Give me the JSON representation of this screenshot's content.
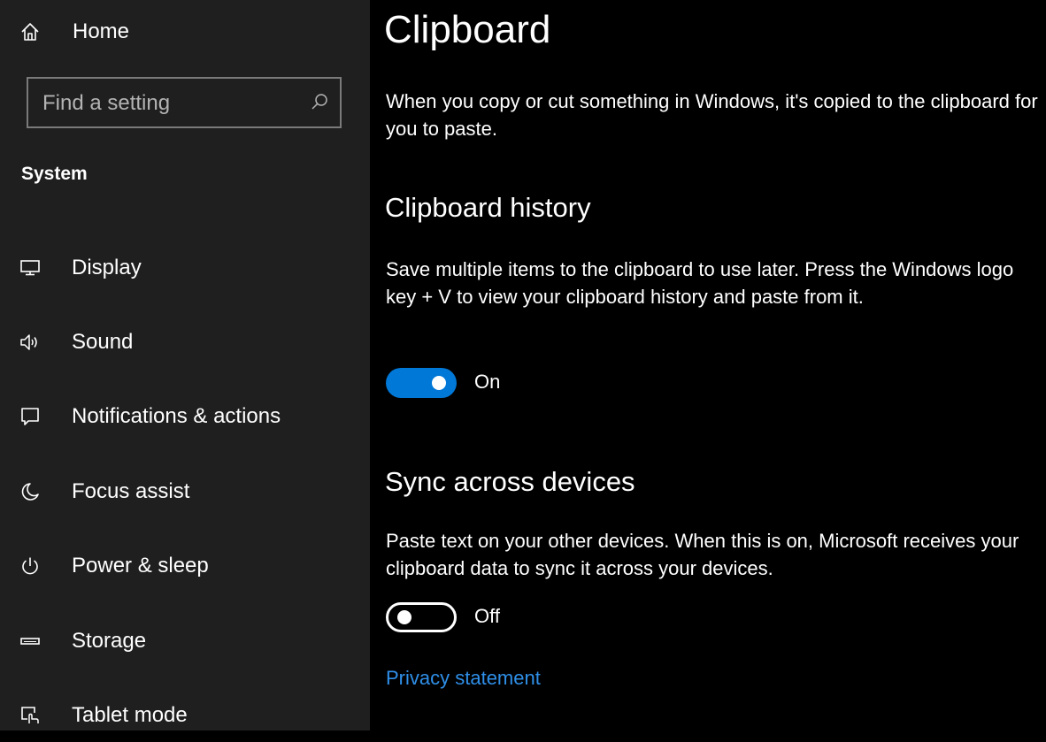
{
  "sidebar": {
    "home_label": "Home",
    "search_placeholder": "Find a setting",
    "section_heading": "System",
    "items": [
      {
        "label": "Display",
        "icon": "display-icon"
      },
      {
        "label": "Sound",
        "icon": "sound-icon"
      },
      {
        "label": "Notifications & actions",
        "icon": "notifications-icon"
      },
      {
        "label": "Focus assist",
        "icon": "focus-assist-icon"
      },
      {
        "label": "Power & sleep",
        "icon": "power-icon"
      },
      {
        "label": "Storage",
        "icon": "storage-icon"
      },
      {
        "label": "Tablet mode",
        "icon": "tablet-mode-icon"
      }
    ]
  },
  "main": {
    "title": "Clipboard",
    "intro": "When you copy or cut something in Windows, it's copied to the clipboard for you to paste.",
    "history": {
      "heading": "Clipboard history",
      "description": "Save multiple items to the clipboard to use later. Press the Windows logo key + V to view your clipboard history and paste from it.",
      "toggle_state": "On",
      "enabled": true
    },
    "sync": {
      "heading": "Sync across devices",
      "description": "Paste text on your other devices. When this is on, Microsoft receives your clipboard data to sync it across your devices.",
      "toggle_state": "Off",
      "enabled": false
    },
    "privacy_link": "Privacy statement"
  },
  "colors": {
    "accent": "#0078d7",
    "link": "#2f8fe8",
    "sidebar_bg": "#1f1f1f",
    "main_bg": "#000000"
  }
}
